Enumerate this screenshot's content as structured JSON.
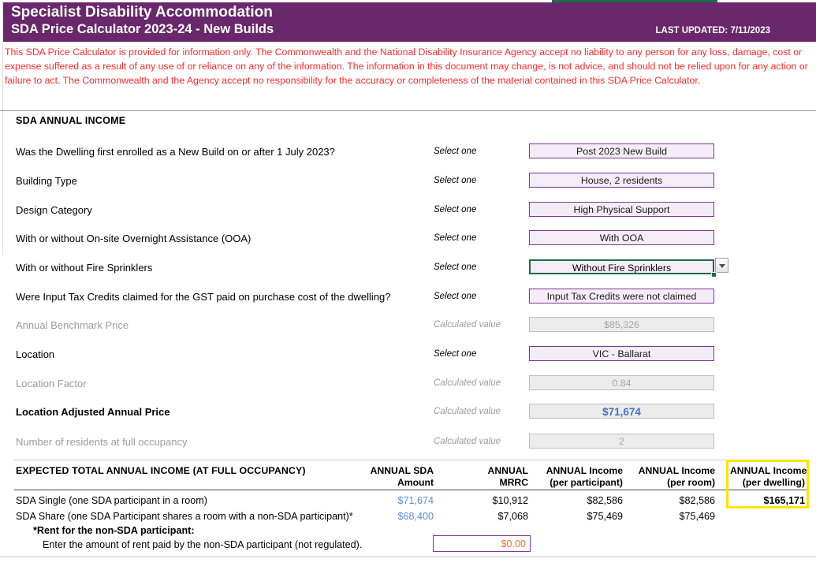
{
  "banner": {
    "title_line1": "Specialist Disability Accommodation",
    "title_line2": "SDA Price Calculator 2023-24 - New Builds",
    "last_updated": "LAST UPDATED: 7/11/2023",
    "background_color": "#69286B"
  },
  "disclaimer": {
    "text": "This SDA Price Calculator is provided for information only.  The Commonwealth and the National Disability Insurance Agency accept no liability to any person for any loss, damage, cost or expense suffered as a result of any use of or reliance on any of the information.  The information in this document may change, is not advice, and should not be relied upon for any action or failure to act. The Commonwealth and the Agency accept no responsibility for the accuracy or completeness of the material contained in this SDA Price Calculator.",
    "color": "#FF2B2B"
  },
  "section": {
    "title": "SDA ANNUAL INCOME"
  },
  "form_rows": [
    {
      "label": "Was the Dwelling first enrolled as a New Build on or after 1 July 2023?",
      "hint": "Select one",
      "value": "Post 2023 New Build",
      "kind": "select"
    },
    {
      "label": "Building Type",
      "hint": "Select one",
      "value": "House, 2 residents",
      "kind": "select"
    },
    {
      "label": "Design Category",
      "hint": "Select one",
      "value": "High Physical Support",
      "kind": "select"
    },
    {
      "label": "With or without On-site Overnight Assistance (OOA)",
      "hint": "Select one",
      "value": "With OOA",
      "kind": "select"
    },
    {
      "label": "With or without Fire Sprinklers",
      "hint": "Select one",
      "value": "Without Fire Sprinklers",
      "kind": "select-active"
    },
    {
      "label": "Were Input Tax Credits claimed for the GST paid on purchase cost of the dwelling?",
      "hint": "Select one",
      "value": "Input Tax Credits were not claimed",
      "kind": "select"
    },
    {
      "label": "Annual Benchmark Price",
      "hint": "Calculated value",
      "value": "$85,326",
      "kind": "calc"
    },
    {
      "label": "Location",
      "hint": "Select one",
      "value": "VIC - Ballarat",
      "kind": "select"
    },
    {
      "label": "Location Factor",
      "hint": "Calculated value",
      "value": "0.84",
      "kind": "calc"
    },
    {
      "label": "Location Adjusted Annual Price",
      "hint": "Calculated value",
      "value": "$71,674",
      "kind": "calc-highlight"
    },
    {
      "label": "Number of residents at full occupancy",
      "hint": "Calculated value",
      "value": "2",
      "kind": "calc"
    }
  ],
  "income_table": {
    "title": "EXPECTED TOTAL ANNUAL INCOME (AT FULL OCCUPANCY)",
    "columns": [
      "ANNUAL SDA\nAmount",
      "ANNUAL\nMRRC",
      "ANNUAL Income\n(per participant)",
      "ANNUAL Income\n(per room)",
      "ANNUAL Income\n(per dwelling)"
    ],
    "columns_split": [
      {
        "line1": "ANNUAL SDA",
        "line2": "Amount"
      },
      {
        "line1": "ANNUAL",
        "line2": "MRRC"
      },
      {
        "line1": "ANNUAL Income",
        "line2": "(per participant)"
      },
      {
        "line1": "ANNUAL Income",
        "line2": "(per room)"
      },
      {
        "line1": "ANNUAL Income",
        "line2": "(per dwelling)"
      }
    ],
    "rows": [
      {
        "label": "SDA Single (one SDA participant in a room)",
        "sda_amount": "$71,674",
        "mrrc": "$10,912",
        "per_participant": "$82,586",
        "per_room": "$82,586",
        "per_dwelling": "$165,171"
      },
      {
        "label": "SDA Share (one SDA Participant shares a room with a non-SDA participant)*",
        "sda_amount": "$68,400",
        "mrrc": "$7,068",
        "per_participant": "$75,469",
        "per_room": "$75,469",
        "per_dwelling": ""
      }
    ],
    "highlight_color": "#FFE500"
  },
  "rent": {
    "note_bold": "*Rent for the non-SDA participant:",
    "note": "Enter the amount of rent paid by the non-SDA participant (not regulated).",
    "value": "$0.00"
  }
}
